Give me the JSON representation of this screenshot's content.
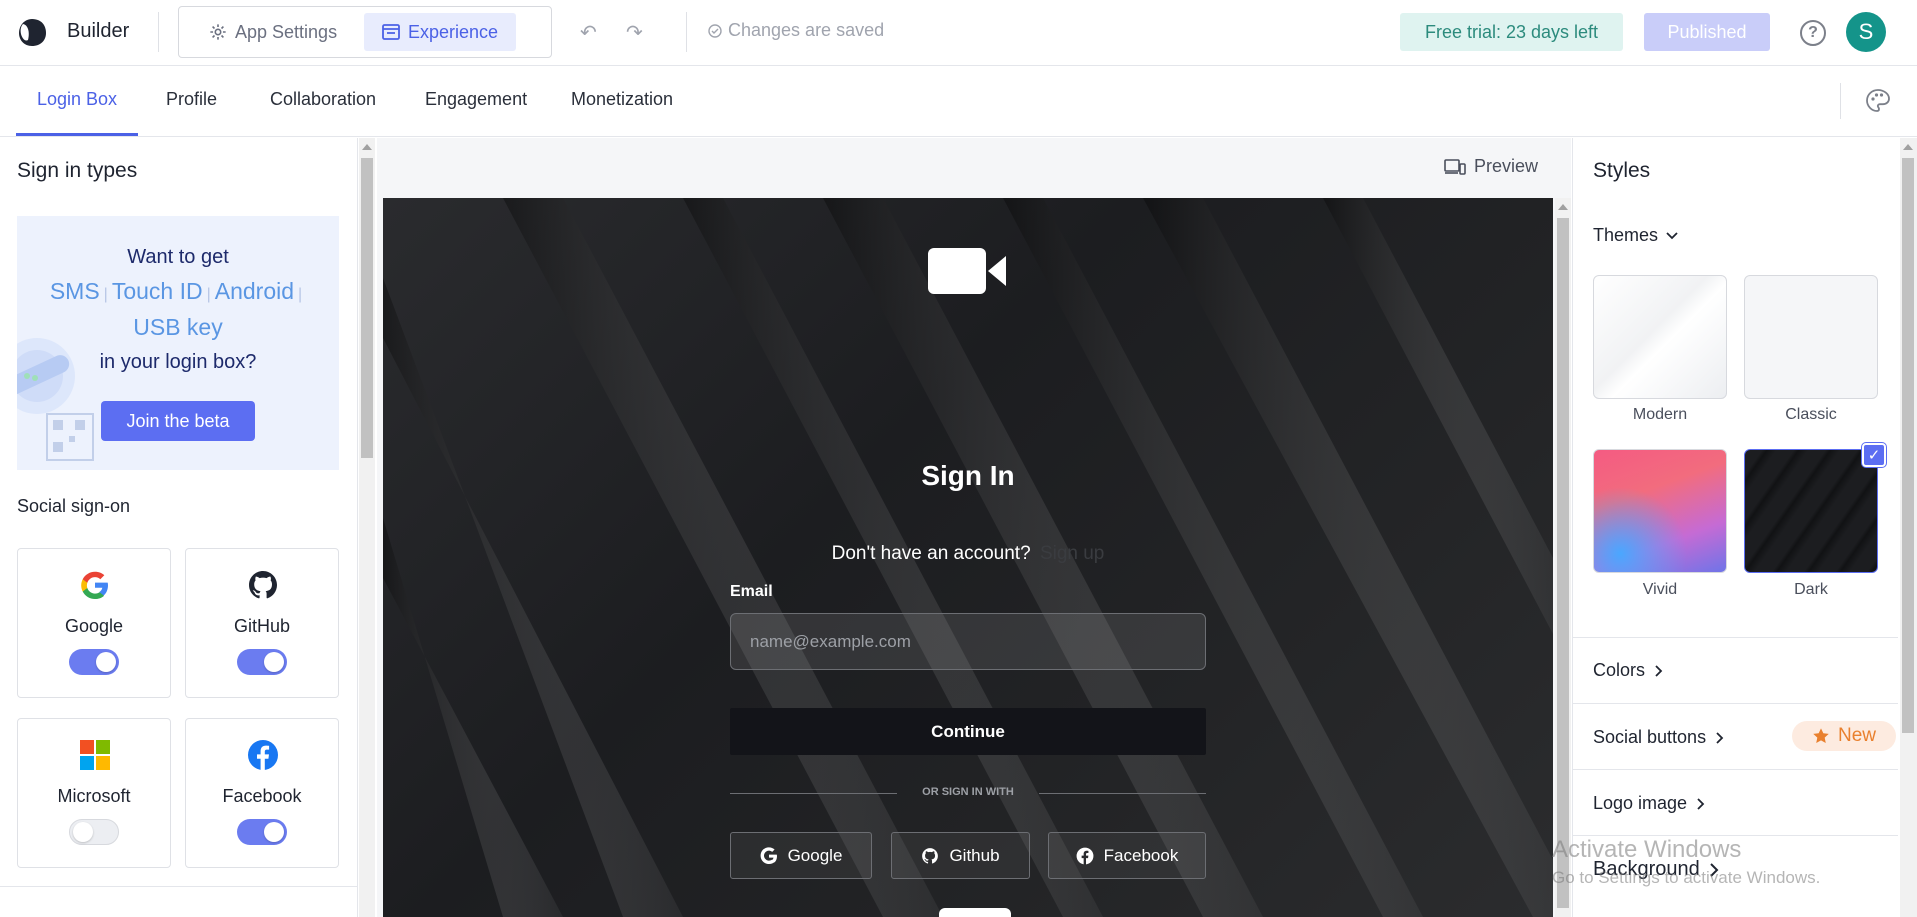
{
  "header": {
    "app_name": "Builder",
    "app_settings_label": "App Settings",
    "experience_label": "Experience",
    "save_status": "Changes are saved",
    "trial_label": "Free trial: 23 days left",
    "published_label": "Published",
    "avatar_initial": "S"
  },
  "tabs": [
    {
      "label": "Login Box"
    },
    {
      "label": "Profile"
    },
    {
      "label": "Collaboration"
    },
    {
      "label": "Engagement"
    },
    {
      "label": "Monetization"
    }
  ],
  "left_panel": {
    "title": "Sign in types",
    "promo": {
      "line1": "Want to get",
      "options_row1": [
        "SMS",
        "Touch ID",
        "Android"
      ],
      "options_row2": "USB key",
      "line4": "in your login box?",
      "cta": "Join the beta"
    },
    "social_title": "Social sign-on",
    "providers": [
      {
        "name": "Google",
        "enabled": true
      },
      {
        "name": "GitHub",
        "enabled": true
      },
      {
        "name": "Microsoft",
        "enabled": false
      },
      {
        "name": "Facebook",
        "enabled": true
      }
    ]
  },
  "center": {
    "preview_label": "Preview",
    "signin_title": "Sign In",
    "no_account_text": "Don't have an account?",
    "signup_link": "Sign up",
    "email_label": "Email",
    "email_placeholder": "name@example.com",
    "continue_label": "Continue",
    "or_text": "OR SIGN IN WITH",
    "social_buttons": [
      "Google",
      "Github",
      "Facebook"
    ]
  },
  "right_panel": {
    "title": "Styles",
    "themes_label": "Themes",
    "themes": [
      {
        "name": "Modern",
        "selected": false
      },
      {
        "name": "Classic",
        "selected": false
      },
      {
        "name": "Vivid",
        "selected": false
      },
      {
        "name": "Dark",
        "selected": true
      }
    ],
    "sections": [
      "Colors",
      "Social buttons",
      "Logo image",
      "Background"
    ],
    "new_badge": "New"
  },
  "watermark": {
    "line1": "Activate Windows",
    "line2": "Go to Settings to activate Windows."
  },
  "colors": {
    "accent": "#4b61e6",
    "toggle_on": "#6b7cf0",
    "trial_bg": "#dff3f0",
    "avatar_bg": "#14948a"
  }
}
